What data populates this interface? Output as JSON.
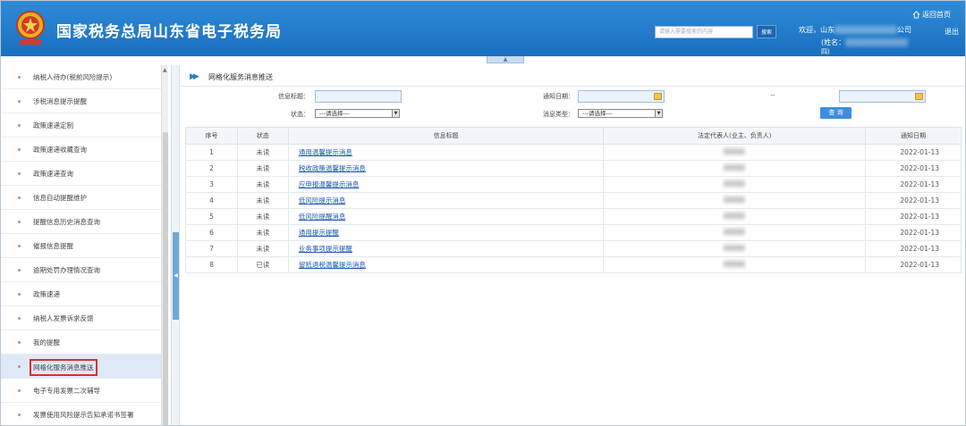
{
  "header": {
    "site_title": "国家税务总局山东省电子税务局",
    "search_placeholder": "请输入需要搜索的内容",
    "search_button": "搜索",
    "welcome_prefix": "欢迎，山东",
    "welcome_suffix": "公司",
    "name_prefix": "(姓名：",
    "name_line2": "四)",
    "home_link": "返回首页",
    "logout": "退出"
  },
  "sidebar": {
    "items": [
      {
        "label": "纳税人待办(税前风险提示)"
      },
      {
        "label": "涉税消息提示提醒"
      },
      {
        "label": "政策速递定制"
      },
      {
        "label": "政策速递收藏查询"
      },
      {
        "label": "政策速递查询"
      },
      {
        "label": "信息自动提醒维护"
      },
      {
        "label": "提醒信息历史消息查询"
      },
      {
        "label": "催报信息提醒"
      },
      {
        "label": "逾期处罚办理情况查询"
      },
      {
        "label": "政策速递"
      },
      {
        "label": "纳税人发票诉求反馈"
      },
      {
        "label": "我的提醒"
      },
      {
        "label": "网格化服务消息推送",
        "active": true
      },
      {
        "label": "电子专用发票二次辅导"
      },
      {
        "label": "发票使用风险提示告知承诺书签署"
      }
    ]
  },
  "main": {
    "page_title": "网格化服务消息推送",
    "filters": {
      "msg_title_label": "信息标题：",
      "notify_date_label": "通知日期：",
      "date_sep": "--",
      "status_label": "状态：",
      "status_value": "---请选择---",
      "msg_type_label": "消息类型：",
      "msg_type_value": "---请选择---",
      "query_button": "查 询"
    },
    "table": {
      "headers": [
        "序号",
        "状态",
        "信息标题",
        "法定代表人(业主、负责人)",
        "通知日期"
      ],
      "rows": [
        {
          "no": "1",
          "status": "未读",
          "title": "通用温馨提示消息",
          "date": "2022-01-13"
        },
        {
          "no": "2",
          "status": "未读",
          "title": "税收政策温馨提示消息",
          "date": "2022-01-13"
        },
        {
          "no": "3",
          "status": "未读",
          "title": "应申报温馨提示消息",
          "date": "2022-01-13"
        },
        {
          "no": "4",
          "status": "未读",
          "title": "低风险提示消息",
          "date": "2022-01-13"
        },
        {
          "no": "5",
          "status": "未读",
          "title": "低风险提醒消息",
          "date": "2022-01-13"
        },
        {
          "no": "6",
          "status": "未读",
          "title": "通用提示提醒",
          "date": "2022-01-13"
        },
        {
          "no": "7",
          "status": "未读",
          "title": "业务事项提示提醒",
          "date": "2022-01-13"
        },
        {
          "no": "8",
          "status": "已读",
          "title": "留抵退税温馨提示消息",
          "date": "2022-01-13"
        }
      ]
    }
  }
}
